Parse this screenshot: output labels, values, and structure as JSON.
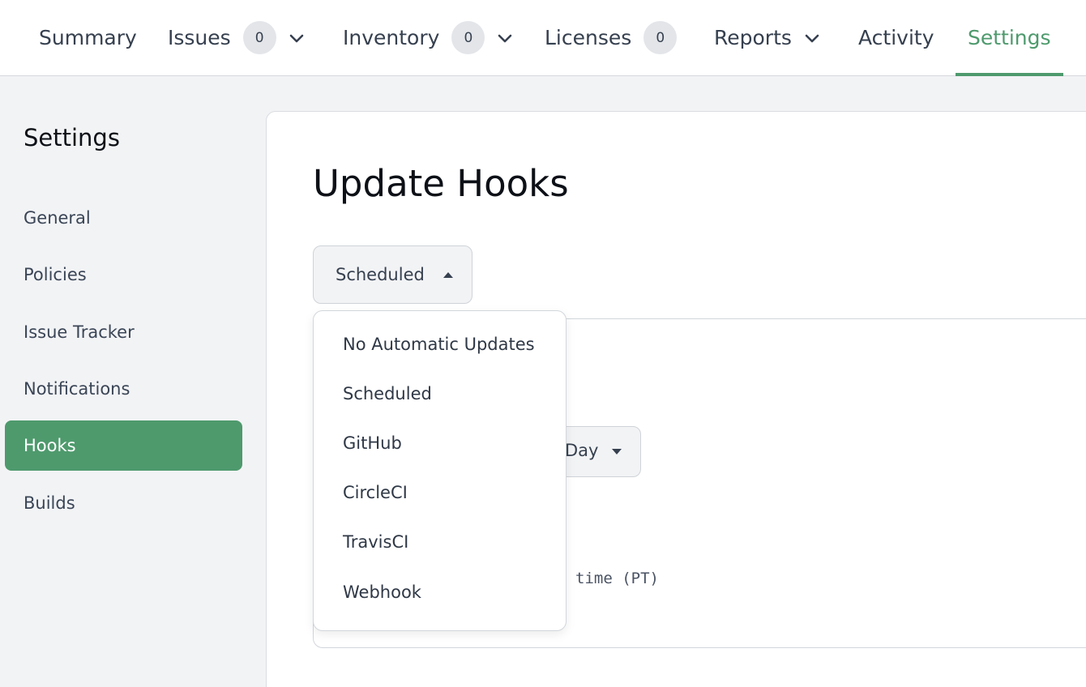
{
  "nav": {
    "tabs": [
      {
        "label": "Summary"
      },
      {
        "label": "Issues",
        "badge": "0"
      },
      {
        "label": "Inventory",
        "badge": "0"
      },
      {
        "label": "Licenses",
        "badge": "0"
      },
      {
        "label": "Reports"
      },
      {
        "label": "Activity"
      },
      {
        "label": "Settings"
      }
    ],
    "active_tab": "Settings",
    "accent_color": "#4e9a6d"
  },
  "sidebar": {
    "title": "Settings",
    "items": [
      {
        "label": "General"
      },
      {
        "label": "Policies"
      },
      {
        "label": "Issue Tracker"
      },
      {
        "label": "Notifications"
      },
      {
        "label": "Hooks"
      },
      {
        "label": "Builds"
      }
    ],
    "active_item": "Hooks"
  },
  "main": {
    "title": "Update Hooks",
    "hook_type": {
      "selected": "Scheduled",
      "icon": "caret-up-icon"
    },
    "frequency": {
      "selected_partial": "Day",
      "icon": "caret-down-icon"
    },
    "time_note_partial": "time (PT)"
  },
  "dropdown": {
    "options": [
      "No Automatic Updates",
      "Scheduled",
      "GitHub",
      "CircleCI",
      "TravisCI",
      "Webhook"
    ]
  }
}
